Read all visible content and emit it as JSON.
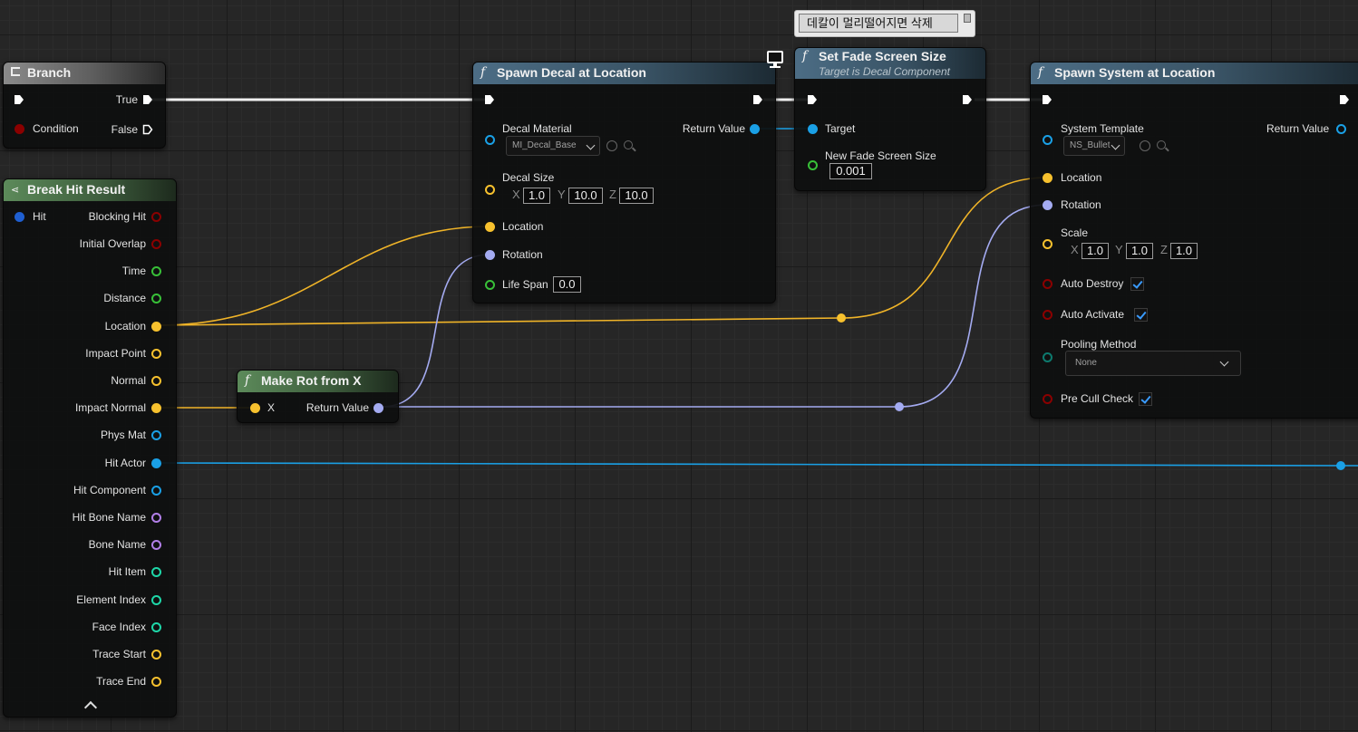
{
  "comment": {
    "text": "데칼이 멀리떨어지면 삭제"
  },
  "branch": {
    "title": "Branch",
    "true_label": "True",
    "condition_label": "Condition",
    "false_label": "False"
  },
  "break_hit": {
    "title": "Break Hit Result",
    "input": "Hit",
    "outputs": [
      "Blocking Hit",
      "Initial Overlap",
      "Time",
      "Distance",
      "Location",
      "Impact Point",
      "Normal",
      "Impact Normal",
      "Phys Mat",
      "Hit Actor",
      "Hit Component",
      "Hit Bone Name",
      "Bone Name",
      "Hit Item",
      "Element Index",
      "Face Index",
      "Trace Start",
      "Trace End"
    ]
  },
  "make_rot": {
    "title": "Make Rot from X",
    "input": "X",
    "output": "Return Value"
  },
  "spawn_decal": {
    "title": "Spawn Decal at Location",
    "decal_material_label": "Decal Material",
    "decal_material_value": "MI_Decal_Base",
    "return_label": "Return Value",
    "decal_size_label": "Decal Size",
    "size_x": "1.0",
    "size_y": "10.0",
    "size_z": "10.0",
    "location_label": "Location",
    "rotation_label": "Rotation",
    "lifespan_label": "Life Span",
    "lifespan_value": "0.0"
  },
  "set_fade": {
    "title": "Set Fade Screen Size",
    "subtitle": "Target is Decal Component",
    "target_label": "Target",
    "fade_label": "New Fade Screen Size",
    "fade_value": "0.001"
  },
  "spawn_system": {
    "title": "Spawn System at Location",
    "template_label": "System Template",
    "template_value": "NS_Bullet",
    "return_label": "Return Value",
    "location_label": "Location",
    "rotation_label": "Rotation",
    "scale_label": "Scale",
    "scale_x": "1.0",
    "scale_y": "1.0",
    "scale_z": "1.0",
    "auto_destroy_label": "Auto Destroy",
    "auto_activate_label": "Auto Activate",
    "pooling_label": "Pooling Method",
    "pooling_value": "None",
    "preculled_label": "Pre Cull Check"
  },
  "axes": {
    "x": "X",
    "y": "Y",
    "z": "Z"
  },
  "colors": {
    "exec": "#ffffff",
    "vector": "#f7c12e",
    "rotator": "#a4abf1",
    "object": "#1aa0e6",
    "bool": "#8b0000",
    "float": "#38c038",
    "struct": "#1f5fd1",
    "name": "#b27fe8",
    "int": "#1ed7a8",
    "enum": "#0d7a6e"
  }
}
